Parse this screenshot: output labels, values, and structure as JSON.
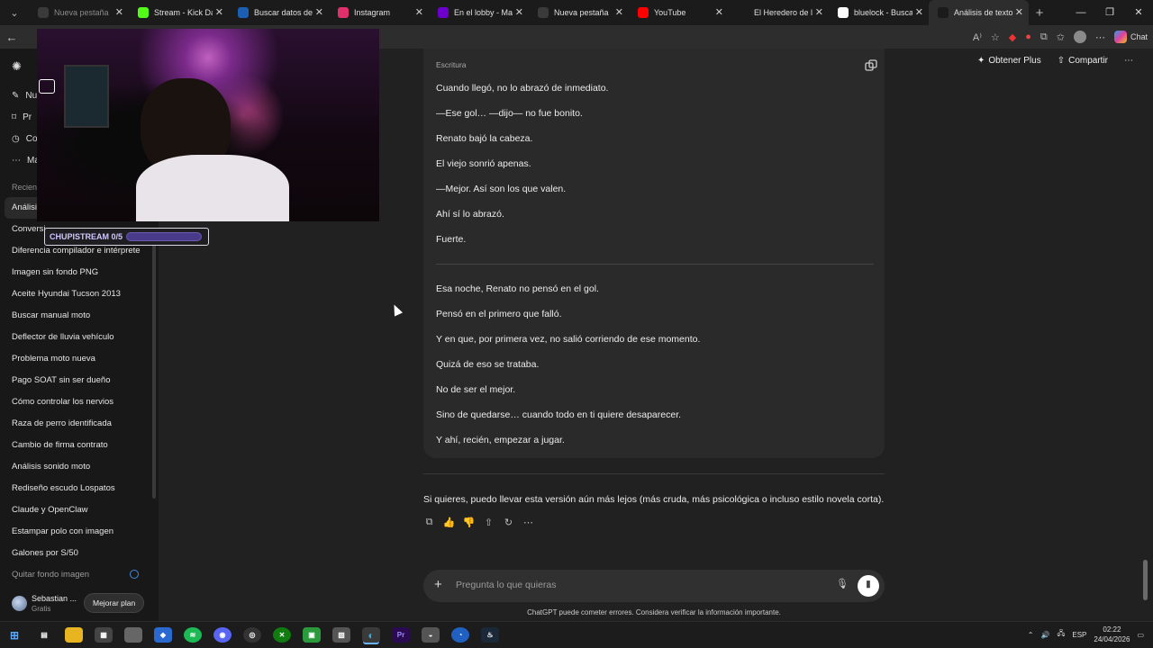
{
  "browser": {
    "tabs": [
      {
        "label": "Nueva pestaña",
        "icon": "page-icon",
        "color": "#3a3a3a",
        "dim": true
      },
      {
        "label": "Stream - Kick Dashb",
        "icon": "kick-icon",
        "color": "#53fc18"
      },
      {
        "label": "Buscar datos de pers",
        "icon": "search-site-icon",
        "color": "#1a5fb4"
      },
      {
        "label": "Instagram",
        "icon": "instagram-icon",
        "color": "#e1306c"
      },
      {
        "label": "En el lobby - Make it",
        "icon": "make-icon",
        "color": "#6d00cc"
      },
      {
        "label": "Nueva pestaña",
        "icon": "page-icon",
        "color": "#3a3a3a"
      },
      {
        "label": "YouTube",
        "icon": "youtube-icon",
        "color": "#ff0000"
      },
      {
        "label": "El Heredero de la Ga",
        "icon": "chatgpt-icon",
        "color": "#1b1b1b"
      },
      {
        "label": "bluelock - Buscar co",
        "icon": "google-icon",
        "color": "#ffffff"
      },
      {
        "label": "Análisis de texto fútb",
        "icon": "chatgpt-icon",
        "color": "#1b1b1b",
        "active": true
      }
    ],
    "copilot_label": "Chat"
  },
  "sidebar": {
    "menu": [
      "Nu",
      "Pr",
      "Co",
      "Ma"
    ],
    "recent_label": "Recien",
    "items": [
      "Análisis",
      "Conversi",
      "Diferencia compilador e intérprete",
      "Imagen sin fondo PNG",
      "Aceite Hyundai Tucson 2013",
      "Buscar manual moto",
      "Deflector de lluvia vehículo",
      "Problema moto nueva",
      "Pago SOAT sin ser dueño",
      "Cómo controlar los nervios",
      "Raza de perro identificada",
      "Cambio de firma contrato",
      "Análisis sonido moto",
      "Rediseño escudo Lospatos",
      "Claude y OpenClaw",
      "Estampar polo con imagen",
      "Galones por S/50",
      "Quitar fondo imagen"
    ],
    "user": {
      "name": "Sebastian ...",
      "plan": "Gratis",
      "upgrade": "Mejorar plan"
    }
  },
  "stream_overlay": {
    "text": "CHUPISTREAM 0/5",
    "progress": 0
  },
  "header": {
    "get_plus": "Obtener Plus",
    "share": "Compartir"
  },
  "card": {
    "label": "Escritura",
    "lines_a": [
      "Cuando llegó, no lo abrazó de inmediato.",
      "—Ese gol… —dijo— no fue bonito.",
      "Renato bajó la cabeza.",
      "El viejo sonrió apenas.",
      "—Mejor. Así son los que valen.",
      "Ahí sí lo abrazó.",
      "Fuerte."
    ],
    "lines_b": [
      "Esa noche, Renato no pensó en el gol.",
      "Pensó en el primero que falló.",
      "Y en que, por primera vez, no salió corriendo de ese momento.",
      "Quizá de eso se trataba.",
      "No de ser el mejor.",
      "Sino de quedarse… cuando todo en ti quiere desaparecer.",
      "Y ahí, recién, empezar a jugar."
    ]
  },
  "closing": "Si quieres, puedo llevar esta versión aún más lejos (más cruda, más psicológica o incluso estilo novela corta).",
  "composer": {
    "placeholder": "Pregunta lo que quieras"
  },
  "disclaimer": "ChatGPT puede cometer errores. Considera verificar la información importante.",
  "taskbar": {
    "lang": "ESP",
    "time": "02:22",
    "date": "24/04/2026"
  }
}
